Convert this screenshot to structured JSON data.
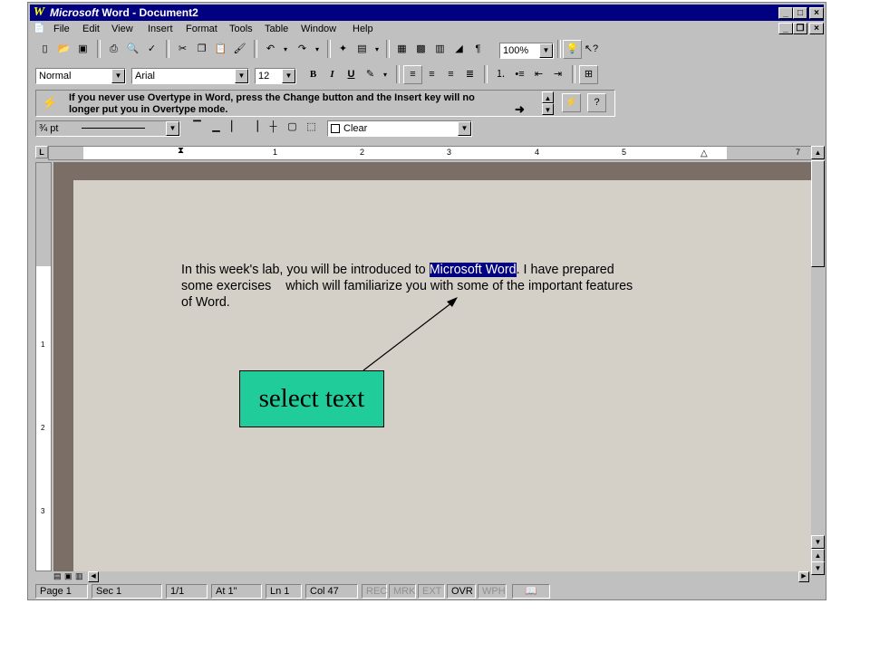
{
  "window": {
    "title": "Microsoft Word - Document2",
    "title_brand": "Microsoft",
    "title_rest": "Word - Document2",
    "app_icon": "W",
    "controls": [
      "_",
      "□",
      "×"
    ],
    "doc_controls": [
      "_",
      "❐",
      "×"
    ]
  },
  "menu": {
    "items": [
      "File",
      "Edit",
      "View",
      "Insert",
      "Format",
      "Tools",
      "Table",
      "Window",
      "Help"
    ]
  },
  "standard_toolbar": {
    "zoom": "100%"
  },
  "formatting_toolbar": {
    "style": "Normal",
    "font": "Arial",
    "size": "12",
    "bold": "B",
    "italic": "I",
    "underline": "U"
  },
  "tip": {
    "text_line1": "If you never use Overtype in Word, press the Change button and the Insert key will no",
    "text_line2": "longer put you in Overtype mode."
  },
  "borders_toolbar": {
    "line_width": "¾ pt",
    "shading": "Clear"
  },
  "ruler": {
    "numbers": [
      "1",
      "2",
      "3",
      "4",
      "5",
      "7"
    ]
  },
  "document": {
    "text_before": "In this week's lab, you will be introduced to ",
    "selected": "Microsoft Word",
    "text_after": ". I have prepared",
    "line2": "some exercises    which will familiarize you with some of the important features",
    "line3": "of Word."
  },
  "annotation": {
    "label": "select text",
    "color": "#1fcc9a"
  },
  "statusbar": {
    "page": "Page 1",
    "sec": "Sec 1",
    "pages": "1/1",
    "at": "At 1\"",
    "ln": "Ln 1",
    "col": "Col 47",
    "rec": "REC",
    "mrk": "MRK",
    "ext": "EXT",
    "ovr": "OVR",
    "wph": "WPH"
  },
  "colors": {
    "titlebar": "#000080",
    "chrome": "#c0c0c0",
    "selection": "#000080"
  }
}
